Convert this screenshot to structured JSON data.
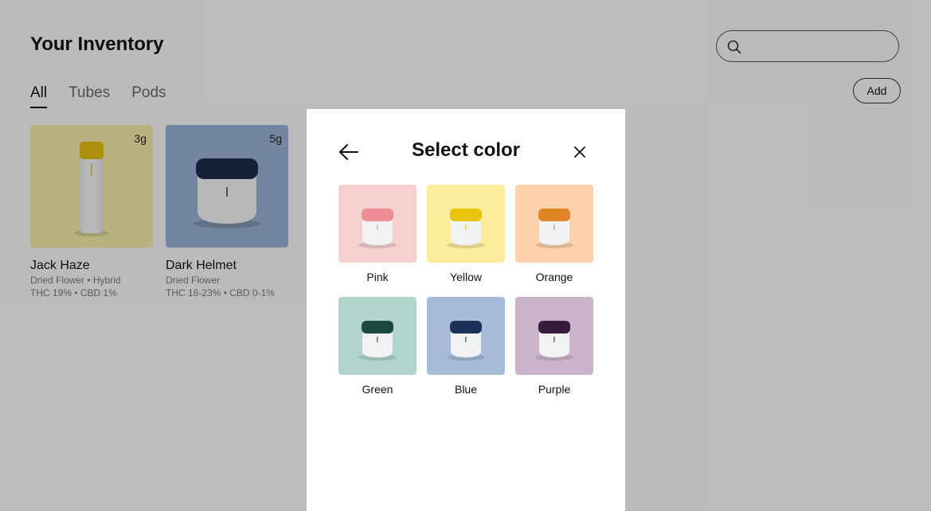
{
  "header": {
    "title": "Your Inventory",
    "search_placeholder": ""
  },
  "tabs": [
    {
      "label": "All",
      "active": true
    },
    {
      "label": "Tubes",
      "active": false
    },
    {
      "label": "Pods",
      "active": false
    }
  ],
  "toolbar": {
    "add_label": "Add"
  },
  "products": [
    {
      "name": "Jack Haze",
      "weight": "3g",
      "line1": "Dried Flower • Hybrid",
      "line2": "THC 19% • CBD 1%",
      "bg": "#f3e8a5",
      "cap": "#e4bc0e"
    },
    {
      "name": "Dark Helmet",
      "weight": "5g",
      "line1": "Dried Flower",
      "line2": "THC 18-23% • CBD 0-1%",
      "bg": "#98aecf",
      "cap": "#1c2c4c"
    }
  ],
  "modal": {
    "title": "Select color",
    "colors": [
      {
        "label": "Pink",
        "bg": "#f4d0d0",
        "cap": "#ec8c95"
      },
      {
        "label": "Yellow",
        "bg": "#fdeb9c",
        "cap": "#e8c40a"
      },
      {
        "label": "Orange",
        "bg": "#fdd1a9",
        "cap": "#e08526"
      },
      {
        "label": "Green",
        "bg": "#b2d4cd",
        "cap": "#1d4840"
      },
      {
        "label": "Blue",
        "bg": "#a6bcd8",
        "cap": "#1d3259"
      },
      {
        "label": "Purple",
        "bg": "#cbb3cb",
        "cap": "#351c3c"
      }
    ]
  }
}
